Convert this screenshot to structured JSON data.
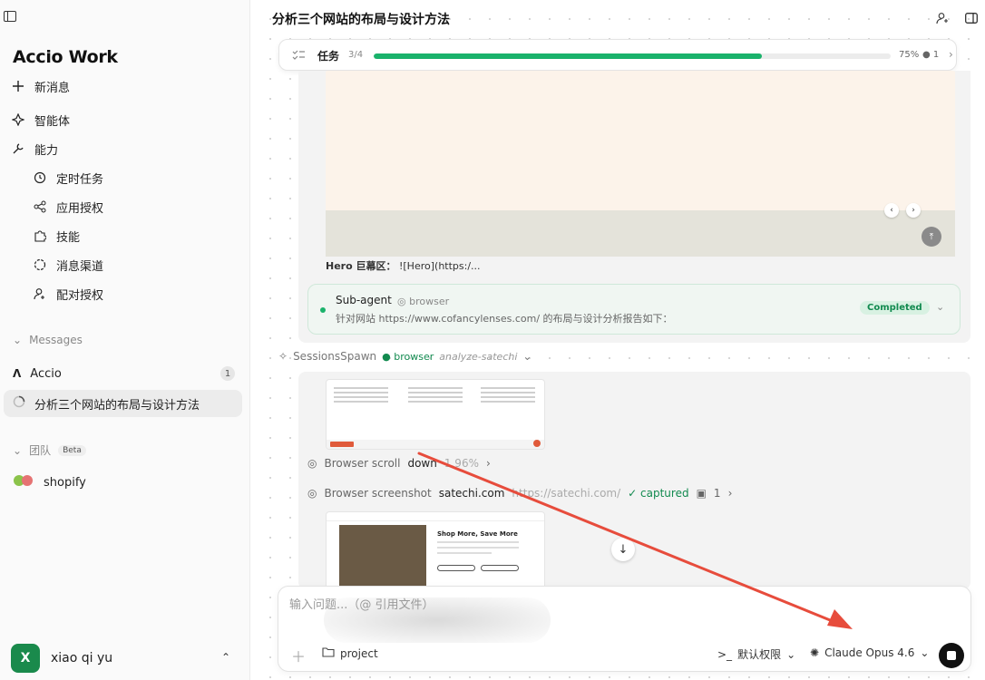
{
  "app": {
    "logo": "Accio Work"
  },
  "sidebar": {
    "nav": [
      {
        "label": "新消息",
        "icon": "plus-icon"
      },
      {
        "label": "智能体",
        "icon": "sparkle-icon"
      },
      {
        "label": "能力",
        "icon": "wrench-icon"
      }
    ],
    "sub_nav": [
      {
        "label": "定时任务",
        "icon": "clock-icon"
      },
      {
        "label": "应用授权",
        "icon": "share-icon"
      },
      {
        "label": "技能",
        "icon": "puzzle-icon"
      },
      {
        "label": "消息渠道",
        "icon": "circle-dashed-icon"
      },
      {
        "label": "配对授权",
        "icon": "user-key-icon"
      }
    ],
    "messages_header": "Messages",
    "messages": [
      {
        "label": "Accio",
        "count": "1"
      },
      {
        "label": "分析三个网站的布局与设计方法"
      }
    ],
    "team_header": "团队",
    "team_badge": "Beta",
    "team": [
      {
        "label": "shopify"
      }
    ],
    "user": {
      "initial": "X",
      "name": "xiao qi yu"
    }
  },
  "main": {
    "title": "分析三个网站的布局与设计方法",
    "task": {
      "label": "任务",
      "count": "3/4",
      "progress": 0.75,
      "percent": "75%",
      "dot_count": "● 1"
    },
    "hero_label": "Hero 巨幕区：",
    "hero_text": "![Hero](https:/...",
    "subagent": {
      "title": "Sub-agent",
      "tag": "browser",
      "desc": "针对网站 https://www.cofancylenses.com/ 的布局与设计分析报告如下：",
      "status": "Completed"
    },
    "spawn": {
      "label": "SessionsSpawn",
      "browser": "browser",
      "args": "analyze-satechi"
    },
    "actions": [
      {
        "label": "Browser scroll",
        "value": "down",
        "extra": "1.96%"
      },
      {
        "label": "Browser screenshot",
        "value": "satechi.com",
        "url": "https://satechi.com/",
        "status": "✓ captured",
        "count": "1"
      }
    ],
    "shot2_heading": "Shop More, Save More"
  },
  "composer": {
    "placeholder": "输入问题...（@ 引用文件）",
    "project": "project",
    "permission": "默认权限",
    "model": "Claude Opus 4.6"
  },
  "colors": {
    "accent": "#1ab26b",
    "arrow": "#e74c3c"
  }
}
